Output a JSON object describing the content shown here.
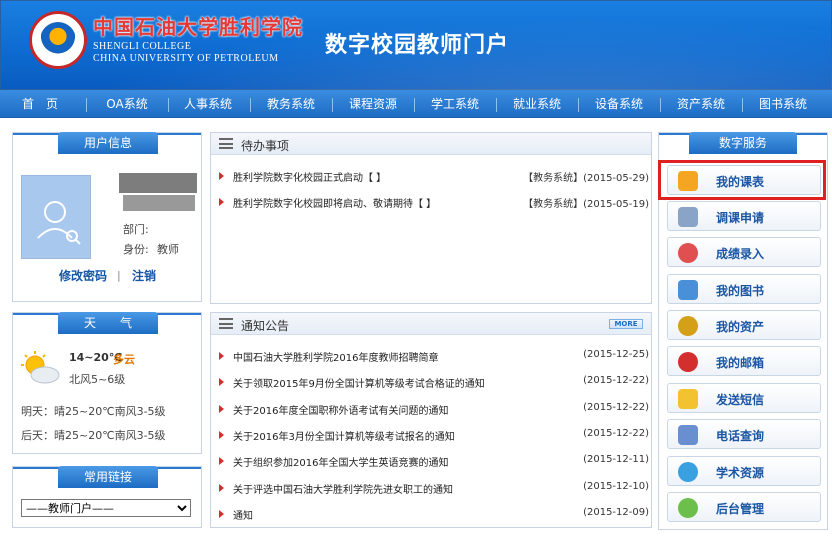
{
  "header": {
    "school_cn": "中国石油大学胜利学院",
    "school_en_1": "SHENGLI COLLEGE",
    "school_en_2": "CHINA UNIVERSITY OF PETROLEUM",
    "portal_title": "数字校园教师门户",
    "logo_icon": "school-emblem-icon"
  },
  "nav": {
    "items": [
      "首　页",
      "OA系统",
      "人事系统",
      "教务系统",
      "课程资源",
      "学工系统",
      "就业系统",
      "设备系统",
      "资产系统",
      "图书系统"
    ]
  },
  "user_info": {
    "title": "用户信息",
    "dept_label": "部门:",
    "identity_label": "身份:",
    "identity_value": "教师",
    "change_password": "修改密码",
    "separator": "|",
    "logout": "注销",
    "avatar_icon": "user-avatar-icon"
  },
  "weather": {
    "title": "天　　气",
    "temp": "14~20℃",
    "condition": "多云",
    "wind": "北风5~6级",
    "tomorrow": "明天：晴25~20℃南风3-5级",
    "after_tomorrow": "后天：晴25~20℃南风3-5级",
    "icon": "partly-cloudy-icon"
  },
  "links": {
    "title": "常用链接",
    "selected": "——教师门户——"
  },
  "todo": {
    "title": "待办事项",
    "items": [
      {
        "text": "胜利学院数字化校园正式启动【 】",
        "meta": "【教务系统】(2015-05-29)"
      },
      {
        "text": "胜利学院数字化校园即将启动、敬请期待【 】",
        "meta": "【教务系统】(2015-05-19)"
      }
    ]
  },
  "notice": {
    "title": "通知公告",
    "more": "MORE",
    "items": [
      {
        "text": "中国石油大学胜利学院2016年度教师招聘简章",
        "date": "(2015-12-25)"
      },
      {
        "text": "关于领取2015年9月份全国计算机等级考试合格证的通知",
        "date": "(2015-12-22)"
      },
      {
        "text": "关于2016年度全国职称外语考试有关问题的通知",
        "date": "(2015-12-22)"
      },
      {
        "text": "关于2016年3月份全国计算机等级考试报名的通知",
        "date": "(2015-12-22)"
      },
      {
        "text": "关于组织参加2016年全国大学生英语竞赛的通知",
        "date": "(2015-12-11)"
      },
      {
        "text": "关于评选中国石油大学胜利学院先进女职工的通知",
        "date": "(2015-12-10)"
      },
      {
        "text": "通知",
        "date": "(2015-12-09)"
      }
    ]
  },
  "services": {
    "title": "数字服务",
    "items": [
      {
        "label": "我的课表",
        "icon": "schedule-icon",
        "color": "#f4a623"
      },
      {
        "label": "调课申请",
        "icon": "pen-paper-icon",
        "color": "#8aa4c8"
      },
      {
        "label": "成绩录入",
        "icon": "person-icon",
        "color": "#e05050"
      },
      {
        "label": "我的图书",
        "icon": "books-icon",
        "color": "#4a90d9"
      },
      {
        "label": "我的资产",
        "icon": "coin-icon",
        "color": "#d4a017"
      },
      {
        "label": "我的邮箱",
        "icon": "medal-icon",
        "color": "#d32f2f"
      },
      {
        "label": "发送短信",
        "icon": "envelope-icon",
        "color": "#f2c230"
      },
      {
        "label": "电话查询",
        "icon": "phone-icon",
        "color": "#6a8fd0"
      },
      {
        "label": "学术资源",
        "icon": "globe-icon",
        "color": "#3aa0e0"
      },
      {
        "label": "后台管理",
        "icon": "gear-icon",
        "color": "#6cbf4a"
      }
    ]
  }
}
